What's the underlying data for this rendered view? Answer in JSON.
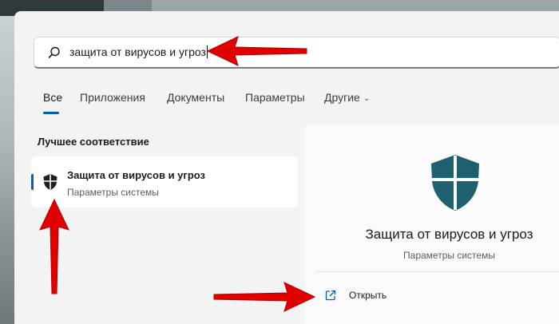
{
  "search": {
    "query": "защита от вирусов и угроз"
  },
  "tabs": [
    {
      "label": "Все",
      "active": true
    },
    {
      "label": "Приложения"
    },
    {
      "label": "Документы"
    },
    {
      "label": "Параметры"
    },
    {
      "label": "Другие"
    }
  ],
  "best_match": {
    "section_title": "Лучшее соответствие",
    "title": "Защита от вирусов и угроз",
    "subtitle": "Параметры системы"
  },
  "detail": {
    "title": "Защита от вирусов и угроз",
    "subtitle": "Параметры системы",
    "open_label": "Открыть"
  },
  "colors": {
    "accent": "#005fb8",
    "shield": "#1f6070",
    "annotation_arrow": "#e00000"
  },
  "icons": [
    "search-icon",
    "shield-icon",
    "chevron-down-icon",
    "open-external-icon"
  ]
}
